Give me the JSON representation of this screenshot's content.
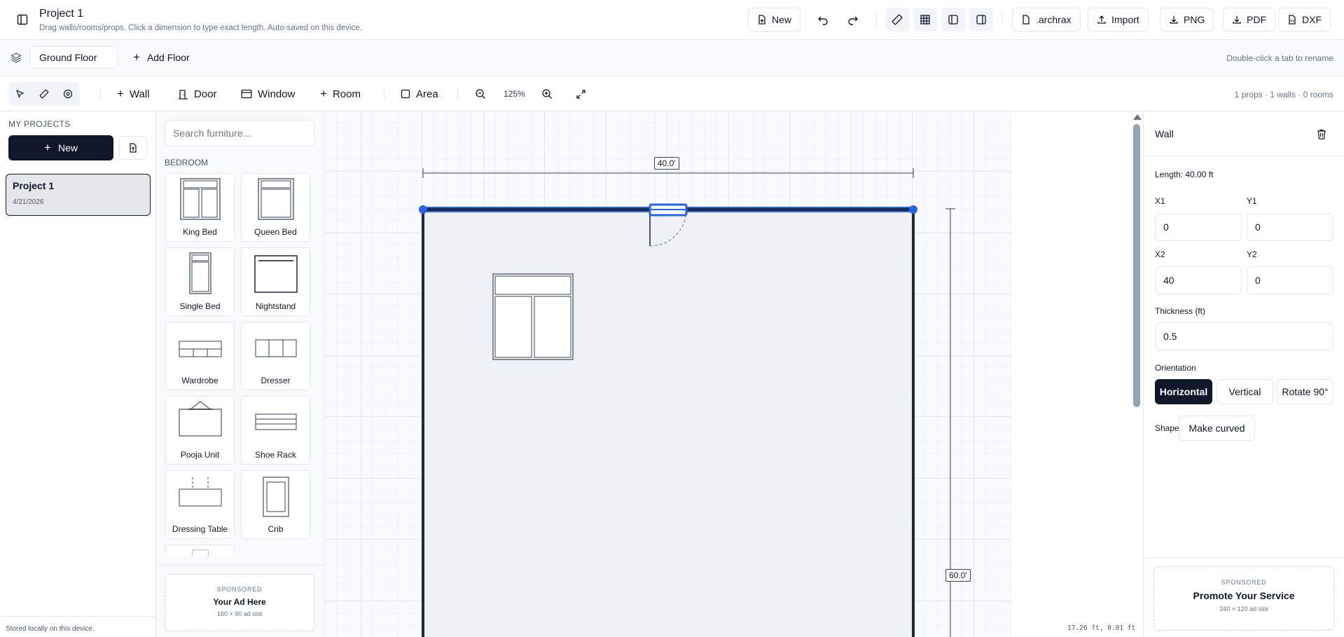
{
  "header": {
    "title": "Project 1",
    "subtitle": "Drag walls/rooms/props. Click a dimension to type exact length. Auto-saved on this device.",
    "new_label": "New",
    "archrax_label": ".archrax",
    "import_label": "Import",
    "png_label": "PNG",
    "pdf_label": "PDF",
    "dxf_label": "DXF"
  },
  "floors": {
    "active_tab": "Ground Floor",
    "add_label": "Add Floor",
    "hint": "Double-click a tab to rename"
  },
  "toolbar": {
    "wall_label": "Wall",
    "door_label": "Door",
    "window_label": "Window",
    "room_label": "Room",
    "area_label": "Area",
    "zoom": "125%",
    "stats": "1 props · 1 walls · 0 rooms"
  },
  "projects": {
    "heading": "MY PROJECTS",
    "new_label": "New",
    "items": [
      {
        "name": "Project 1",
        "date": "4/21/2026"
      }
    ],
    "footer": "Stored locally on this device."
  },
  "library": {
    "search_placeholder": "Search furniture...",
    "category": "BEDROOM",
    "items": [
      "King Bed",
      "Queen Bed",
      "Single Bed",
      "Nightstand",
      "Wardrobe",
      "Dresser",
      "Pooja Unit",
      "Shoe Rack",
      "Dressing Table",
      "Crib"
    ],
    "ad": {
      "tag": "SPONSORED",
      "title": "Your Ad Here",
      "size": "160 × 90 ad slot"
    }
  },
  "canvas": {
    "width_dim": "40.0'",
    "height_dim": "60.0'",
    "cursor": "17.26 ft, 0.01 ft"
  },
  "inspector": {
    "title": "Wall",
    "length": "Length: 40.00 ft",
    "x1_label": "X1",
    "x1": "0",
    "y1_label": "Y1",
    "y1": "0",
    "x2_label": "X2",
    "x2": "40",
    "y2_label": "Y2",
    "y2": "0",
    "thickness_label": "Thickness (ft)",
    "thickness": "0.5",
    "orientation_label": "Orientation",
    "horizontal_label": "Horizontal",
    "vertical_label": "Vertical",
    "rotate_label": "Rotate 90°",
    "shape_label": "Shape",
    "curve_label": "Make curved",
    "ad": {
      "tag": "SPONSORED",
      "title": "Promote Your Service",
      "size": "240 × 120 ad slot"
    }
  },
  "colors": {
    "accent": "#0f172a",
    "selection": "#2563eb",
    "canvas_bg": "#f1f5f9"
  }
}
